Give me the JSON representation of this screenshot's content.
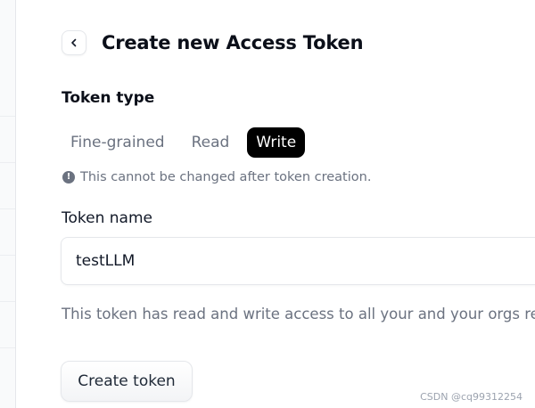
{
  "header": {
    "back_icon": "chevron-left-icon",
    "title": "Create new Access Token"
  },
  "token_type": {
    "label": "Token type",
    "tabs": [
      {
        "label": "Fine-grained",
        "active": false
      },
      {
        "label": "Read",
        "active": false
      },
      {
        "label": "Write",
        "active": true
      }
    ],
    "note_icon": "exclamation-circle-icon",
    "note": "This cannot be changed after token creation."
  },
  "token_name": {
    "label": "Token name",
    "value": "testLLM"
  },
  "description": "This token has read and write access to all your and your orgs res",
  "create_button_label": "Create token",
  "watermark": "CSDN @cq99312254",
  "colors": {
    "active_tab_bg": "#000000",
    "muted_text": "#6b7280",
    "border": "#e5e7eb"
  }
}
